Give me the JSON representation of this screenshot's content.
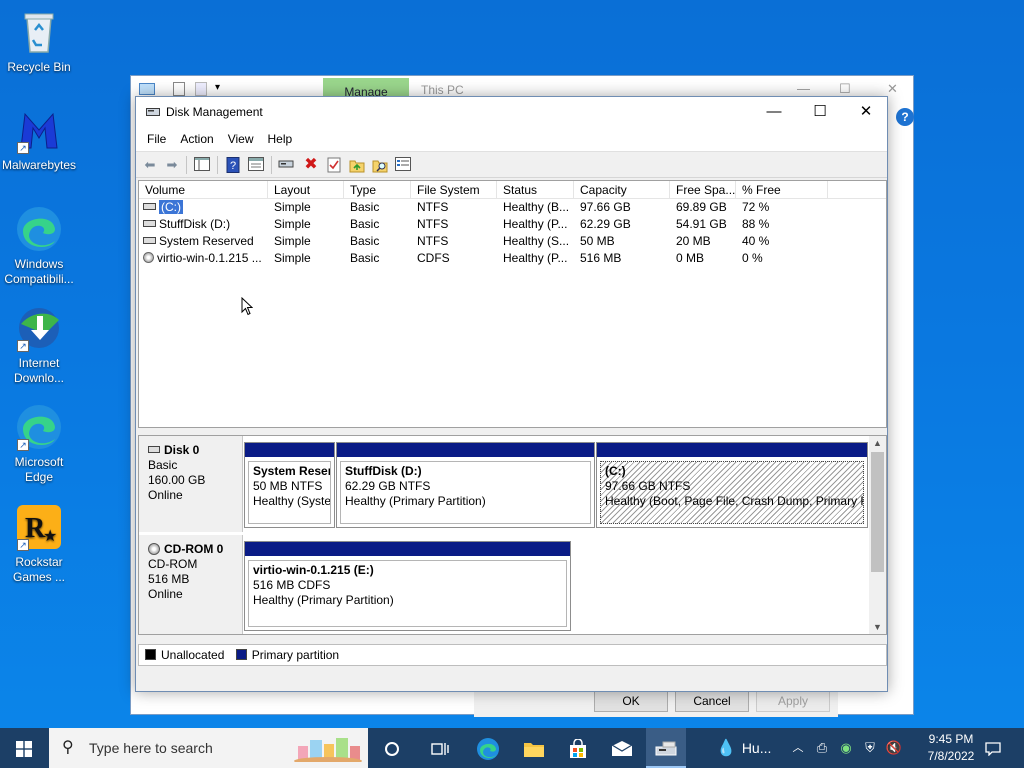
{
  "desktop": {
    "icons": [
      {
        "label": "Recycle Bin",
        "icon": "recycle-bin-icon"
      },
      {
        "label": "Malwarebytes",
        "icon": "malwarebytes-icon"
      },
      {
        "label": "Windows Compatibili...",
        "icon": "edge-icon"
      },
      {
        "label": "Internet Downlo...",
        "icon": "idm-icon"
      },
      {
        "label": "Microsoft Edge",
        "icon": "edge-icon"
      },
      {
        "label": "Rockstar Games ...",
        "icon": "rockstar-icon"
      }
    ]
  },
  "background_window": {
    "manage_tab": "Manage",
    "title": "This PC",
    "help": "?",
    "ok": "OK",
    "cancel": "Cancel",
    "apply": "Apply"
  },
  "window": {
    "title": "Disk Management",
    "menu": [
      "File",
      "Action",
      "View",
      "Help"
    ]
  },
  "list": {
    "columns": [
      "Volume",
      "Layout",
      "Type",
      "File System",
      "Status",
      "Capacity",
      "Free Spa...",
      "% Free"
    ],
    "rows": [
      [
        "(C:)",
        "Simple",
        "Basic",
        "NTFS",
        "Healthy (B...",
        "97.66 GB",
        "69.89 GB",
        "72 %"
      ],
      [
        "StuffDisk (D:)",
        "Simple",
        "Basic",
        "NTFS",
        "Healthy (P...",
        "62.29 GB",
        "54.91 GB",
        "88 %"
      ],
      [
        "System Reserved",
        "Simple",
        "Basic",
        "NTFS",
        "Healthy (S...",
        "50 MB",
        "20 MB",
        "40 %"
      ],
      [
        "virtio-win-0.1.215 ...",
        "Simple",
        "Basic",
        "CDFS",
        "Healthy (P...",
        "516 MB",
        "0 MB",
        "0 %"
      ]
    ]
  },
  "disks": {
    "disk0": {
      "name": "Disk 0",
      "type": "Basic",
      "size": "160.00 GB",
      "state": "Online",
      "partitions": [
        {
          "name": "System Reser",
          "size": "50 MB NTFS",
          "status": "Healthy (Syste"
        },
        {
          "name": "StuffDisk  (D:)",
          "size": "62.29 GB NTFS",
          "status": "Healthy (Primary Partition)"
        },
        {
          "name": "(C:)",
          "size": "97.66 GB NTFS",
          "status": "Healthy (Boot, Page File, Crash Dump, Primary Pa"
        }
      ]
    },
    "cdrom0": {
      "name": "CD-ROM 0",
      "type": "CD-ROM",
      "size": "516 MB",
      "state": "Online",
      "partitions": [
        {
          "name": "virtio-win-0.1.215  (E:)",
          "size": "516 MB CDFS",
          "status": "Healthy (Primary Partition)"
        }
      ]
    }
  },
  "legend": {
    "unallocated": "Unallocated",
    "primary": "Primary partition"
  },
  "taskbar": {
    "search_placeholder": "Type here to search",
    "pinned_label": "Hu...",
    "time": "9:45 PM",
    "date": "7/8/2022"
  },
  "colors": {
    "primary_partition": "#0a1b86",
    "unallocated": "#000000",
    "accent": "#0078d7"
  }
}
